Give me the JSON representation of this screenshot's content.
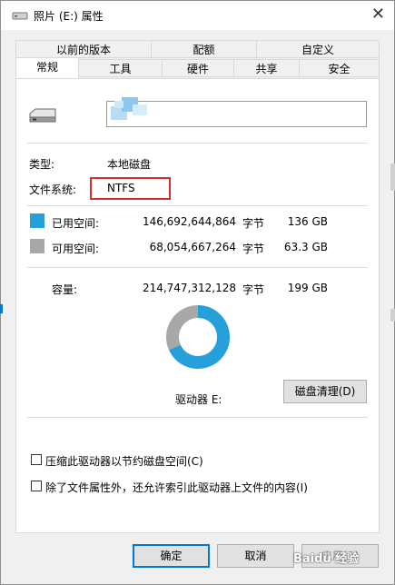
{
  "window": {
    "title": "照片 (E:) 属性"
  },
  "tabs": {
    "row1": [
      "以前的版本",
      "配额",
      "自定义"
    ],
    "row2": [
      "常规",
      "工具",
      "硬件",
      "共享",
      "安全"
    ]
  },
  "general": {
    "type_label": "类型:",
    "type_value": "本地磁盘",
    "fs_label": "文件系统:",
    "fs_value": "NTFS",
    "used_label": "已用空间:",
    "used_bytes": "146,692,644,864",
    "used_unit": "字节",
    "used_size": "136 GB",
    "free_label": "可用空间:",
    "free_bytes": "68,054,667,264",
    "free_unit": "字节",
    "free_size": "63.3 GB",
    "capacity_label": "容量:",
    "capacity_bytes": "214,747,312,128",
    "capacity_unit": "字节",
    "capacity_size": "199 GB",
    "drive_label": "驱动器 E:",
    "cleanup_label": "磁盘清理(D)",
    "compress_label": "压缩此驱动器以节约磁盘空间(C)",
    "index_label": "除了文件属性外，还允许索引此驱动器上文件的内容(I)"
  },
  "chart_data": {
    "type": "pie",
    "categories": [
      "已用空间",
      "可用空间"
    ],
    "values": [
      146692644864,
      68054667264
    ],
    "colors": [
      "#26a0da",
      "#a8a8a8"
    ]
  },
  "footer": {
    "ok_label": "确定",
    "cancel_label": "取消",
    "apply_label": "应用(A)"
  },
  "watermark": {
    "text": "Baidu 经验"
  },
  "colors": {
    "used": "#26a0da",
    "free": "#a8a8a8",
    "highlight": "#d32f2f",
    "accent": "#0078d7"
  }
}
